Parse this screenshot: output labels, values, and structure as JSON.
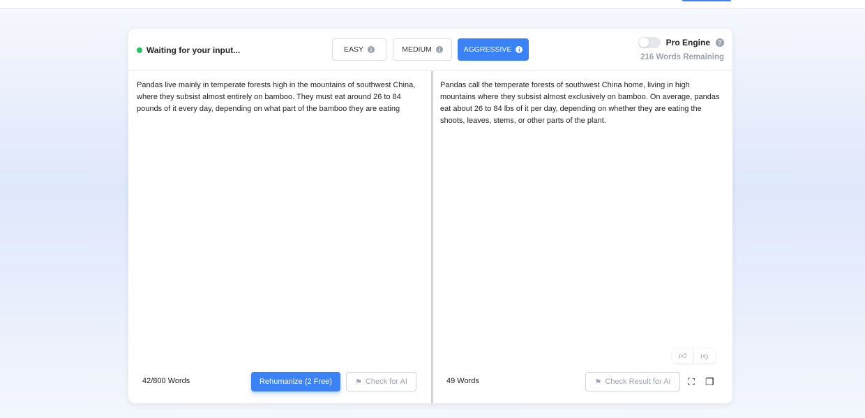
{
  "status": {
    "text": "Waiting for your input...",
    "color": "#22c55e"
  },
  "modes": [
    {
      "label": "EASY",
      "active": false
    },
    {
      "label": "MEDIUM",
      "active": false
    },
    {
      "label": "AGGRESSIVE",
      "active": true
    }
  ],
  "accent": "#3b82f6",
  "pro_engine": {
    "label": "Pro Engine",
    "enabled": false,
    "remaining": "216 Words Remaining"
  },
  "input": {
    "text": "Pandas live mainly in temperate forests high in the mountains of southwest China, where they subsist almost entirely on bamboo. They must eat around 26 to 84 pounds of it every day, depending on what part of the bamboo they are eating",
    "word_count": "42/800 Words",
    "rehumanize_label": "Rehumanize (2 Free)",
    "check_label": "Check for AI"
  },
  "output": {
    "text": "Pandas call the temperate forests of southwest China home, living in high mountains where they subsist almost exclusively on bamboo. On average, pandas eat about 26 to 84 lbs of it per day, depending on whether they are eating the shoots, leaves, stems, or other parts of the plant.",
    "word_count": "49 Words",
    "check_label": "Check Result for AI"
  }
}
